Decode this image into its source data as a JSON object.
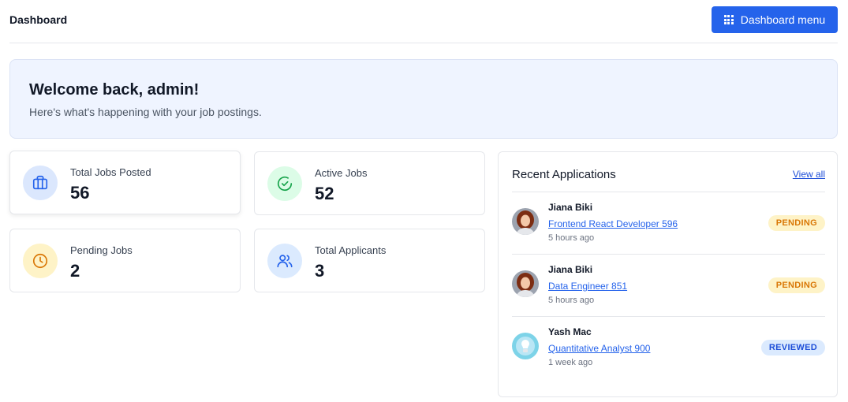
{
  "header": {
    "title": "Dashboard",
    "menu_button": "Dashboard menu"
  },
  "welcome": {
    "title": "Welcome back, admin!",
    "subtitle": "Here's what's happening with your job postings."
  },
  "stats": [
    {
      "label": "Total Jobs Posted",
      "value": "56",
      "icon": "briefcase-icon",
      "color": "#2563eb",
      "bg": "#dbe7fd"
    },
    {
      "label": "Active Jobs",
      "value": "52",
      "icon": "check-circle-icon",
      "color": "#16a34a",
      "bg": "#dcfce7"
    },
    {
      "label": "Pending Jobs",
      "value": "2",
      "icon": "clock-icon",
      "color": "#d97706",
      "bg": "#fef3c7"
    },
    {
      "label": "Total Applicants",
      "value": "3",
      "icon": "users-icon",
      "color": "#2563eb",
      "bg": "#dbeafe"
    }
  ],
  "recent": {
    "title": "Recent Applications",
    "view_all": "View all",
    "items": [
      {
        "name": "Jiana Biki",
        "job": "Frontend React Developer 596",
        "time": "5 hours ago",
        "status": "PENDING"
      },
      {
        "name": "Jiana Biki",
        "job": "Data Engineer 851",
        "time": "5 hours ago",
        "status": "PENDING"
      },
      {
        "name": "Yash Mac",
        "job": "Quantitative Analyst 900",
        "time": "1 week ago",
        "status": "REVIEWED"
      }
    ]
  }
}
